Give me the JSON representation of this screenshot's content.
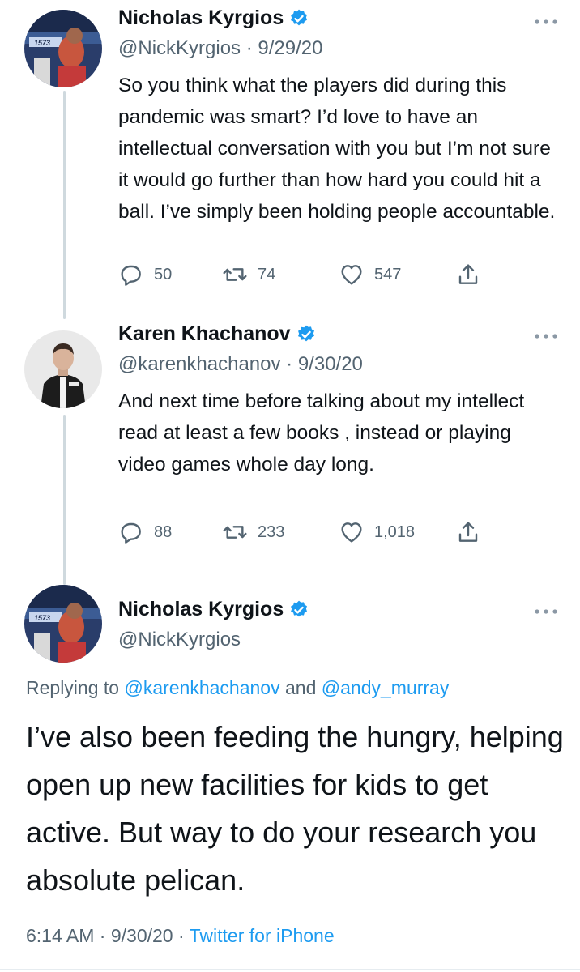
{
  "colors": {
    "text": "#0f1419",
    "muted": "#536471",
    "accent": "#1d9bf0",
    "thread": "#cfd9de"
  },
  "tweets": [
    {
      "name": "Nicholas Kyrgios",
      "handle": "@NickKyrgios",
      "date": "9/29/20",
      "separator": "·",
      "verified": true,
      "text": "So you think what the players did during this pandemic was smart? I’d love to have an intellectual conversation with you but I’m not sure it would go further than how hard you could hit a ball. I’ve simply been holding people accountable.",
      "replies": "50",
      "retweets": "74",
      "likes": "547"
    },
    {
      "name": "Karen Khachanov",
      "handle": "@karenkhachanov",
      "date": "9/30/20",
      "separator": "·",
      "verified": true,
      "text": "And next time before talking about my intellect read at least a few books , instead or playing video games whole day long.",
      "replies": "88",
      "retweets": "233",
      "likes": "1,018"
    }
  ],
  "main_tweet": {
    "name": "Nicholas Kyrgios",
    "handle": "@NickKyrgios",
    "verified": true,
    "replying_prefix": "Replying to",
    "replying_user1": "@karenkhachanov",
    "replying_and": "and",
    "replying_user2": "@andy_murray",
    "text": "I’ve also been feeding the hungry, helping open up new facilities for kids to get active. But way to do your research you absolute pelican.",
    "time": "6:14 AM",
    "date": "9/30/20",
    "separator": "·",
    "source": "Twitter for iPhone"
  },
  "avatar_texts": {
    "kyrgios_bib": "1573"
  },
  "icons": [
    "verified-badge-icon",
    "more-options-icon",
    "reply-icon",
    "retweet-icon",
    "like-icon",
    "share-icon"
  ]
}
